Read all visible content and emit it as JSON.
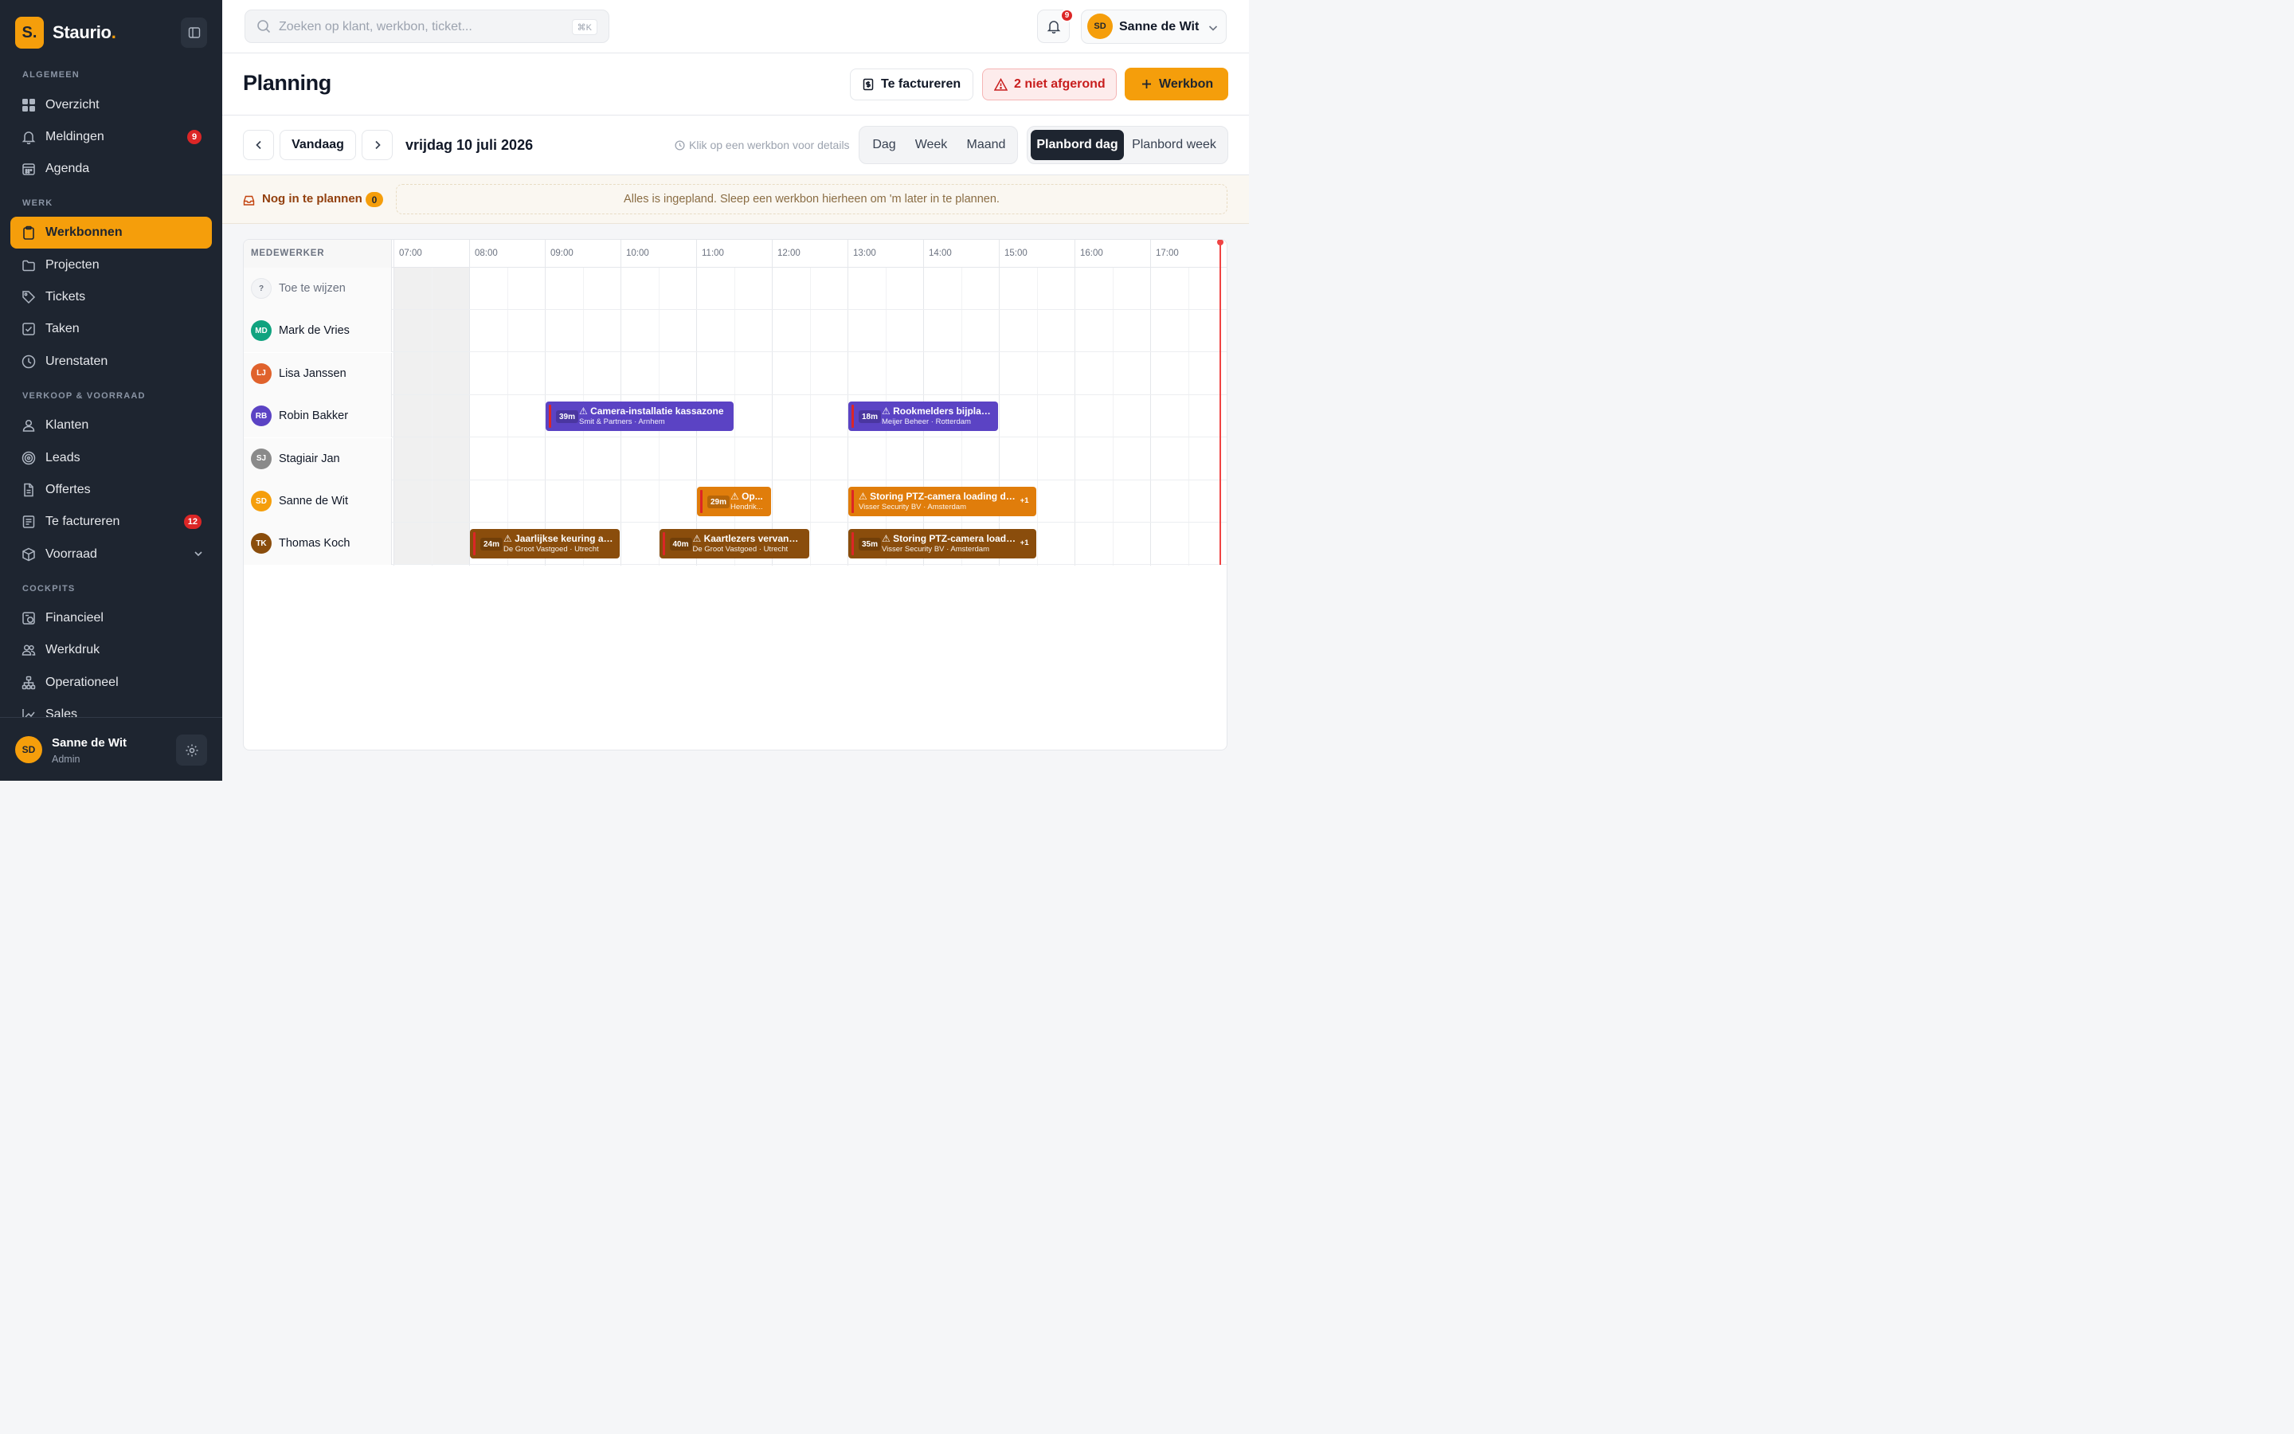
{
  "app": {
    "logo_letter": "S.",
    "name": "Staurio",
    "name_dot": "."
  },
  "sidebar": {
    "sections": {
      "algemeen": "ALGEMEEN",
      "werk": "WERK",
      "verkoop": "VERKOOP & VOORRAAD",
      "cockpits": "COCKPITS"
    },
    "items": {
      "overzicht": "Overzicht",
      "meldingen": "Meldingen",
      "meldingen_badge": "9",
      "agenda": "Agenda",
      "werkbonnen": "Werkbonnen",
      "projecten": "Projecten",
      "tickets": "Tickets",
      "taken": "Taken",
      "urenstaten": "Urenstaten",
      "klanten": "Klanten",
      "leads": "Leads",
      "offertes": "Offertes",
      "te_factureren": "Te factureren",
      "te_factureren_badge": "12",
      "voorraad": "Voorraad",
      "financieel": "Financieel",
      "werkdruk": "Werkdruk",
      "operationeel": "Operationeel",
      "sales": "Sales"
    },
    "user": {
      "initials": "SD",
      "name": "Sanne de Wit",
      "role": "Admin"
    }
  },
  "topbar": {
    "search_placeholder": "Zoeken op klant, werkbon, ticket...",
    "search_shortcut": "⌘K",
    "notifications_count": "9",
    "user_initials": "SD",
    "user_name": "Sanne de Wit"
  },
  "header": {
    "title": "Planning",
    "btn_facturen": "Te factureren",
    "btn_warn": "2 niet afgerond",
    "btn_new": "Werkbon"
  },
  "toolbar": {
    "today": "Vandaag",
    "date": "vrijdag 10 juli 2026",
    "hint": "Klik op een werkbon voor details",
    "views": {
      "dag": "Dag",
      "week": "Week",
      "maand": "Maand"
    },
    "boards": {
      "dag": "Planbord dag",
      "week": "Planbord week"
    },
    "active_board": "Planbord dag"
  },
  "backlog": {
    "label": "Nog in te plannen",
    "count": "0",
    "empty": "Alles is ingepland. Sleep een werkbon hierheen om 'm later in te plannen."
  },
  "grid": {
    "column_label": "MEDEWERKER",
    "hours": [
      "07:00",
      "08:00",
      "09:00",
      "10:00",
      "11:00",
      "12:00",
      "13:00",
      "14:00",
      "15:00",
      "16:00",
      "17:00"
    ],
    "rows": [
      {
        "initials": "?",
        "name": "Toe te wijzen",
        "color": "#f3f4f6"
      },
      {
        "initials": "MD",
        "name": "Mark de Vries",
        "color": "#10a37f"
      },
      {
        "initials": "LJ",
        "name": "Lisa Janssen",
        "color": "#e0622c"
      },
      {
        "initials": "RB",
        "name": "Robin Bakker",
        "color": "#5b43c4"
      },
      {
        "initials": "SJ",
        "name": "Stagiair Jan",
        "color": "#8a8a8a"
      },
      {
        "initials": "SD",
        "name": "Sanne de Wit",
        "color": "#f59e0b"
      },
      {
        "initials": "TK",
        "name": "Thomas Koch",
        "color": "#8a4d0c"
      }
    ],
    "events": [
      {
        "row": 3,
        "start": "09:00",
        "end": "11:30",
        "dur": "39m",
        "title": "⚠ Camera-installatie kassazone",
        "sub": "Smit & Partners · Arnhem",
        "theme": "purple",
        "more": ""
      },
      {
        "row": 3,
        "start": "13:00",
        "end": "15:00",
        "dur": "18m",
        "title": "⚠ Rookmelders bijplaat...",
        "sub": "Meijer Beheer · Rotterdam",
        "theme": "purple",
        "more": ""
      },
      {
        "row": 5,
        "start": "11:00",
        "end": "12:00",
        "dur": "29m",
        "title": "⚠ Op...",
        "sub": "Hendrik...",
        "theme": "orange",
        "more": ""
      },
      {
        "row": 5,
        "start": "13:00",
        "end": "15:30",
        "dur": "",
        "title": "⚠ Storing PTZ-camera loading dock",
        "sub": "Visser Security BV · Amsterdam",
        "theme": "orange",
        "more": "+1"
      },
      {
        "row": 6,
        "start": "08:00",
        "end": "10:00",
        "dur": "24m",
        "title": "⚠ Jaarlijkse keuring ala...",
        "sub": "De Groot Vastgoed · Utrecht",
        "theme": "brown",
        "more": ""
      },
      {
        "row": 6,
        "start": "10:30",
        "end": "12:30",
        "dur": "40m",
        "title": "⚠ Kaartlezers vervange...",
        "sub": "De Groot Vastgoed · Utrecht",
        "theme": "brown",
        "more": ""
      },
      {
        "row": 6,
        "start": "13:00",
        "end": "15:30",
        "dur": "35m",
        "title": "⚠ Storing PTZ-camera loading...",
        "sub": "Visser Security BV · Amsterdam",
        "theme": "brown",
        "more": "+1"
      }
    ],
    "now_time": "17:55"
  }
}
